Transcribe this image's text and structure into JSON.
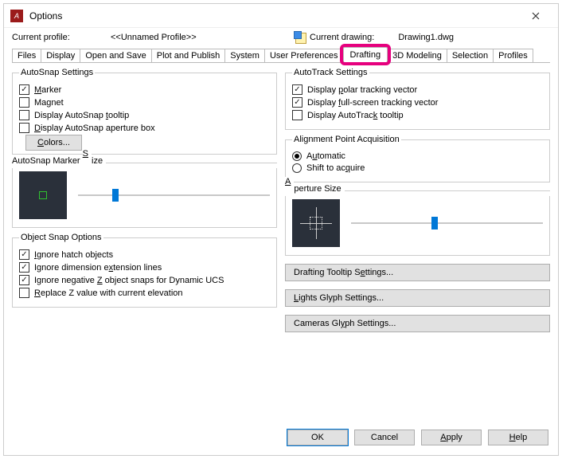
{
  "window": {
    "title": "Options"
  },
  "topline": {
    "profile_label": "Current profile:",
    "profile_name": "<<Unnamed Profile>>",
    "drawing_label": "Current drawing:",
    "drawing_name": "Drawing1.dwg"
  },
  "tabs": [
    "Files",
    "Display",
    "Open and Save",
    "Plot and Publish",
    "System",
    "User Preferences",
    "Drafting",
    "3D Modeling",
    "Selection",
    "Profiles"
  ],
  "active_tab": "Drafting",
  "autosnap": {
    "legend": "AutoSnap Settings",
    "marker": "Marker",
    "magnet": "Magnet",
    "tooltip": "Display AutoSnap tooltip",
    "aperture": "Display AutoSnap aperture box"
  },
  "autosnap_state": {
    "marker": true,
    "magnet": false,
    "tooltip": false,
    "aperture": false
  },
  "colors_btn": "Colors...",
  "autotrack": {
    "legend": "AutoTrack Settings",
    "polar": "Display polar tracking vector",
    "full": "Display full-screen tracking vector",
    "tooltip": "Display AutoTrack tooltip"
  },
  "autotrack_state": {
    "polar": true,
    "full": true,
    "tooltip": false
  },
  "alignment": {
    "legend": "Alignment Point Acquisition",
    "auto": "Automatic",
    "shift": "Shift to acquire",
    "value": "auto"
  },
  "markerSize": {
    "label": "AutoSnap Marker Size",
    "value": 18
  },
  "apertureSize": {
    "label": "Aperture Size",
    "value": 42
  },
  "osnap": {
    "legend": "Object Snap Options",
    "hatch": "Ignore hatch objects",
    "dim": "Ignore dimension extension lines",
    "negz": "Ignore negative Z object snaps for Dynamic UCS",
    "replace": "Replace Z value with current elevation"
  },
  "osnap_state": {
    "hatch": true,
    "dim": true,
    "negz": true,
    "replace": false
  },
  "buttons": {
    "tooltipSettings": "Drafting Tooltip Settings...",
    "lights": "Lights Glyph Settings...",
    "cameras": "Cameras Glyph Settings..."
  },
  "footer": {
    "ok": "OK",
    "cancel": "Cancel",
    "apply": "Apply",
    "help": "Help"
  }
}
